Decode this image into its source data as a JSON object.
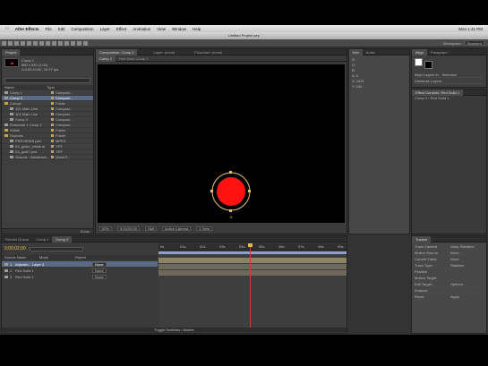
{
  "menubar": {
    "apple": "",
    "items": [
      "After Effects",
      "File",
      "Edit",
      "Composition",
      "Layer",
      "Effect",
      "Animation",
      "View",
      "Window",
      "Help"
    ],
    "status": "Mon 1:41 PM"
  },
  "window": {
    "title": "Untitled Project.aep"
  },
  "toolbar": {
    "workspace_label": "Workspace:",
    "workspace_value": "Standard"
  },
  "project": {
    "tab": "Project",
    "info_name": "Comp 1",
    "info_line1": "960 x 540 (1.00)",
    "info_line2": "Δ 0;00;10;00, 29.97 fps",
    "search_placeholder": "",
    "col_name": "Name",
    "col_type": "Type",
    "items": [
      {
        "name": "Comp 1",
        "type": "Composi...",
        "kind": "comp",
        "indent": 0
      },
      {
        "name": "Comp 2",
        "type": "Composi...",
        "kind": "comp",
        "indent": 0,
        "selected": true
      },
      {
        "name": "Comps",
        "type": "Folder",
        "kind": "folder",
        "indent": 0
      },
      {
        "name": "101 Main Line",
        "type": "Composi...",
        "kind": "comp",
        "indent": 2
      },
      {
        "name": "101 Main Line",
        "type": "Composi...",
        "kind": "comp",
        "indent": 2
      },
      {
        "name": "Comp 3",
        "type": "Composi...",
        "kind": "comp",
        "indent": 2
      },
      {
        "name": "Flowchart 1 Comp 1",
        "type": "Composi...",
        "kind": "comp",
        "indent": 0
      },
      {
        "name": "Solids",
        "type": "Folder",
        "kind": "folder",
        "indent": 0
      },
      {
        "name": "Sources",
        "type": "Folder",
        "kind": "folder",
        "indent": 0
      },
      {
        "name": "PREVIEWS.psd",
        "type": "MPEG",
        "kind": "file",
        "indent": 2
      },
      {
        "name": "03_globe_rotate.ai",
        "type": "TIFF",
        "kind": "file",
        "indent": 2
      },
      {
        "name": "03_gold7.psd",
        "type": "TIFF",
        "kind": "file",
        "indent": 2
      },
      {
        "name": "Sounds - Backtrack...",
        "type": "QuickTi...",
        "kind": "file",
        "indent": 2
      }
    ],
    "footer": "8 bpc"
  },
  "composition": {
    "tabs": [
      "Composition: Comp 2",
      "Layer: (none)",
      "Flowchart: (none)"
    ],
    "subtabs": [
      "Comp 2",
      "Red Solid Comp 1"
    ],
    "zoom": "50%",
    "timecode": "0;00;02;00",
    "quality": "Half",
    "camera": "Active Camera",
    "view": "1 View"
  },
  "info_panel": {
    "tabs": [
      "Info",
      "Audio"
    ],
    "rows": [
      "R:",
      "G:",
      "B:",
      "A: 0",
      "X: 1021",
      "Y: 244"
    ]
  },
  "preview_panel": {
    "tabs": [
      "Preview",
      "Effects & Presets"
    ]
  },
  "effects_panel": {
    "title": "Effect Controls: Red Solid 1",
    "subtitle": "Comp 2 • Red Solid 1"
  },
  "timeline": {
    "tabs": [
      "Render Queue",
      "Comp 1",
      "Comp 2"
    ],
    "timecode": "0;00;02;00",
    "search_placeholder": "",
    "col_source": "Source Name",
    "col_mode": "Mode",
    "col_parent": "Parent",
    "layers": [
      {
        "num": "1",
        "name": "Adjustm... Layer 3",
        "mode": "None",
        "selected": true
      },
      {
        "num": "2",
        "name": "Red Solid 1",
        "mode": "None"
      },
      {
        "num": "3",
        "name": "Red Solid 1",
        "mode": "None"
      }
    ],
    "ruler": [
      "0s",
      "01s",
      "02s",
      "03s",
      "04s",
      "05s",
      "06s",
      "07s",
      "08s",
      "09s"
    ],
    "footer": "Toggle Switches / Modes"
  },
  "character_panel": {
    "tabs": [
      "Align",
      "Paragraph"
    ],
    "rows": [
      {
        "label": "Align Layers to:",
        "value": "Selection"
      },
      {
        "label": "Distribute Layers:",
        "value": ""
      }
    ]
  },
  "tracker_panel": {
    "tabs": [
      "Tracker"
    ],
    "rows": [
      {
        "label": "Track Camera",
        "value": "Warp Stabilizer"
      },
      {
        "label": "Motion Source:",
        "value": "None"
      },
      {
        "label": "Current Track:",
        "value": "None"
      },
      {
        "label": "Track Type:",
        "value": "Stabilize"
      },
      {
        "label": "Position",
        "value": ""
      },
      {
        "label": "Motion Target:",
        "value": ""
      },
      {
        "label": "Edit Target...",
        "value": "Options..."
      },
      {
        "label": "Analyze:",
        "value": ""
      },
      {
        "label": "Reset",
        "value": "Apply"
      }
    ]
  },
  "colors": {
    "accent_red": "#ff1212",
    "selection": "#5a6a86",
    "playhead": "#d43a3a",
    "work_area": "#8aa0c8"
  }
}
